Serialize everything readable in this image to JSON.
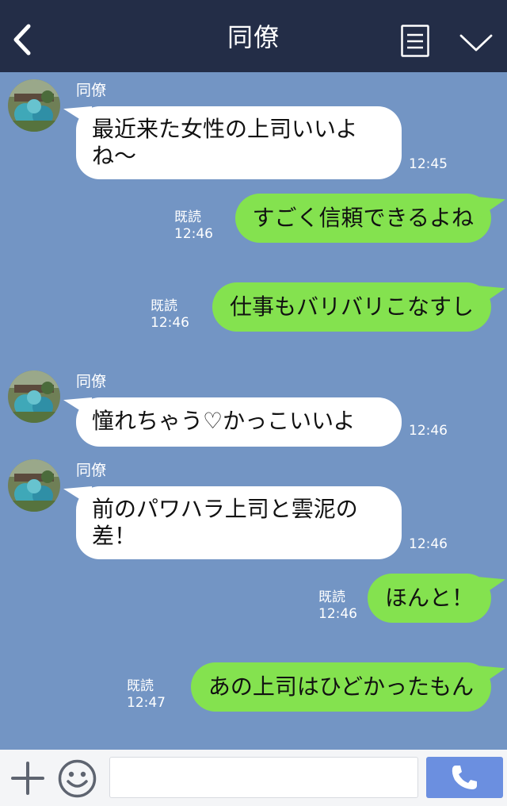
{
  "header": {
    "title": "同僚",
    "back_icon": "chevron-left-icon",
    "notes_icon": "notes-icon",
    "menu_icon": "chevron-down-icon"
  },
  "messages": [
    {
      "direction": "incoming",
      "sender": "同僚",
      "lines": [
        "最近来た女性の上司いいよ",
        "ね〜"
      ],
      "time": "12:45"
    },
    {
      "direction": "outgoing",
      "read": "既読",
      "text": "すごく信頼できるよね",
      "time": "12:46"
    },
    {
      "direction": "outgoing",
      "read": "既読",
      "text": "仕事もバリバリこなすし",
      "time": "12:46"
    },
    {
      "direction": "incoming",
      "sender": "同僚",
      "lines": [
        "憧れちゃう♡かっこいいよ"
      ],
      "time": "12:46"
    },
    {
      "direction": "incoming",
      "sender": "同僚",
      "lines": [
        "前のパワハラ上司と雲泥の",
        "差！"
      ],
      "time": "12:46"
    },
    {
      "direction": "outgoing",
      "read": "既読",
      "text": "ほんと！",
      "time": "12:46"
    },
    {
      "direction": "outgoing",
      "read": "既読",
      "text": "あの上司はひどかったもん",
      "time": "12:47"
    }
  ],
  "footer": {
    "plus_icon": "plus-icon",
    "emoji_icon": "smiley-icon",
    "input_value": "",
    "call_icon": "phone-icon"
  },
  "colors": {
    "header_bg": "#232d47",
    "chat_bg": "#7395c4",
    "incoming_bubble": "#ffffff",
    "outgoing_bubble": "#84e24f",
    "call_button": "#6b8fe0"
  }
}
